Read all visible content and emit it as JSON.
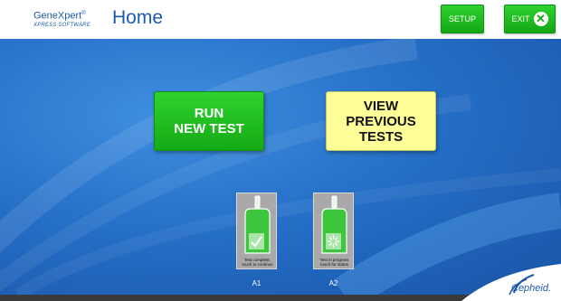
{
  "header": {
    "logo_main": "GeneXpert",
    "logo_reg": "®",
    "logo_sub": "XPRESS SOFTWARE",
    "title": "Home",
    "setup_label": "SETUP",
    "exit_label": "EXIT"
  },
  "main": {
    "run_test_line1": "RUN",
    "run_test_line2": "NEW TEST",
    "view_tests_line1": "VIEW",
    "view_tests_line2": "PREVIOUS",
    "view_tests_line3": "TESTS",
    "modules": [
      {
        "label": "A1",
        "status_line1": "Test complete,",
        "status_line2": "touch to continue",
        "state": "complete"
      },
      {
        "label": "A2",
        "status_line1": "Test in progress",
        "status_line2": "touch for status",
        "state": "in-progress"
      }
    ]
  },
  "footer": {
    "brand": "Cepheid."
  },
  "colors": {
    "accent_green": "#1fbf1f",
    "brand_blue": "#1e5aa8",
    "view_yellow": "#ffff99",
    "background_blue": "#2670c8"
  }
}
